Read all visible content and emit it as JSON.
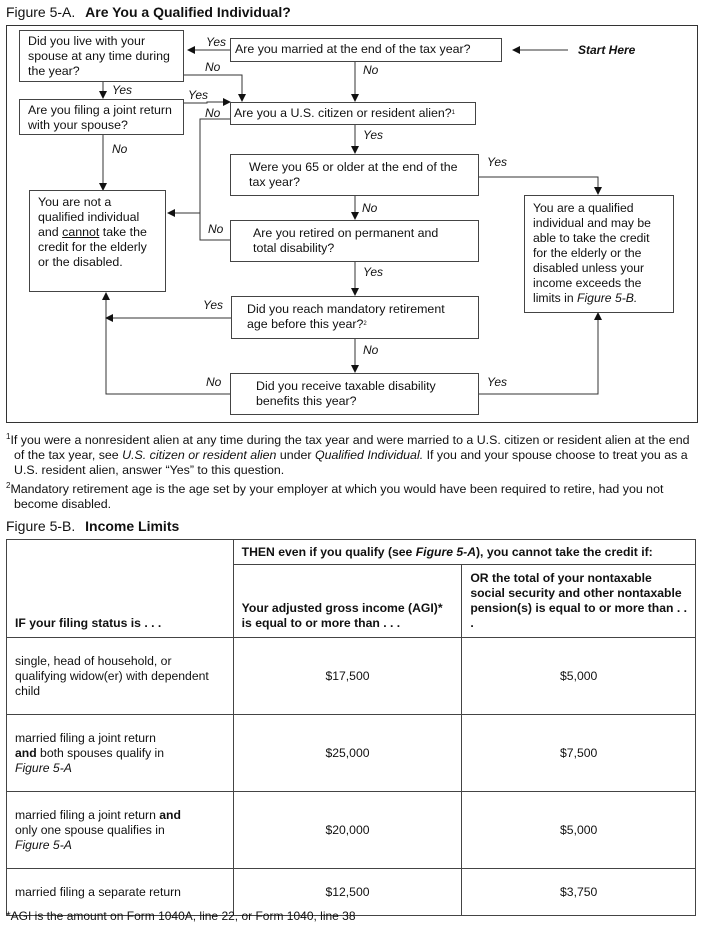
{
  "figure_a": {
    "number": "Figure 5-A.",
    "title": "Are You a Qualified Individual?",
    "start_here": "Start Here",
    "nodes": {
      "married": "Are you married at the end of the tax year?",
      "live_with_spouse": "Did you live with your spouse at any time during the year?",
      "joint_return": "Are you filing a joint return with your spouse?",
      "citizen": "Are you a U.S. citizen or resident alien?",
      "citizen_footnote": "1",
      "age65": "Were you 65 or older at the end of the tax year?",
      "retired_disability": "Are you retired on permanent and total disability?",
      "mandatory_retirement": "Did you reach mandatory retirement age before this year?",
      "mandatory_footnote": "2",
      "taxable_benefits": "Did you receive taxable disability benefits this year?",
      "not_qualified_pre": "You are not a qualified individual and ",
      "not_qualified_emph": "cannot",
      "not_qualified_post": " take the credit for the elderly or the disabled.",
      "qualified_pre": "You are a qualified individual and may be able to take the credit for the elderly or the disabled unless your income exceeds the limits in ",
      "qualified_ref": "Figure 5-B."
    },
    "edge_labels": {
      "married_yes": "Yes",
      "married_no": "No",
      "live_no": "No",
      "live_yes": "Yes",
      "joint_yes": "Yes",
      "joint_no": "No",
      "citizen_no": "No",
      "citizen_yes": "Yes",
      "age65_yes": "Yes",
      "age65_no": "No",
      "retired_yes": "Yes",
      "mandatory_yes": "Yes",
      "mandatory_no": "No",
      "benefits_no": "No",
      "benefits_yes": "Yes"
    }
  },
  "footnotes": [
    {
      "marker": "1",
      "text_a": "If you were a nonresident alien at any time during the tax year and were married to a U.S. citizen or resident alien at the end of the tax year, see ",
      "italic_a": "U.S. citizen or resident alien",
      "text_b": " under ",
      "italic_b": "Qualified Individual.",
      "text_c": " If you and your spouse choose to treat you as a U.S. resident alien, answer “Yes” to this question."
    },
    {
      "marker": "2",
      "text": "Mandatory retirement age is the age set by your employer at which you would have been required to retire, had you not become disabled."
    }
  ],
  "figure_b": {
    "number": "Figure 5-B.",
    "title": "Income Limits",
    "header_then_pre": "THEN even if you qualify (see ",
    "header_then_ref": "Figure 5-A",
    "header_then_post": "), you cannot take the credit if:",
    "col_status": "IF your filing status is . . .",
    "col_agi": "Your adjusted gross income (AGI)* is equal to or more than . . .",
    "col_nontaxable": "OR the total of your nontaxable social security and other nontaxable pension(s) is equal to or more than . . .",
    "rows": [
      {
        "status_a": "single, head of household, or qualifying widow(er) with dependent child",
        "status_bold": "",
        "status_b": "",
        "status_ref": "",
        "agi": "$17,500",
        "nontaxable": "$5,000"
      },
      {
        "status_a": "married filing a joint return ",
        "status_bold": "and",
        "status_b": " both spouses qualify in ",
        "status_ref": "Figure 5-A",
        "agi": "$25,000",
        "nontaxable": "$7,500"
      },
      {
        "status_a": "married filing a joint return ",
        "status_bold": "and",
        "status_b": " only one spouse qualifies in ",
        "status_ref": "Figure 5-A",
        "agi": "$20,000",
        "nontaxable": "$5,000"
      },
      {
        "status_a": "married filing a separate return",
        "status_bold": "",
        "status_b": "",
        "status_ref": "",
        "agi": "$12,500",
        "nontaxable": "$3,750"
      }
    ],
    "agi_note": "*AGI is the amount on Form 1040A, line 22, or Form 1040, line 38"
  }
}
